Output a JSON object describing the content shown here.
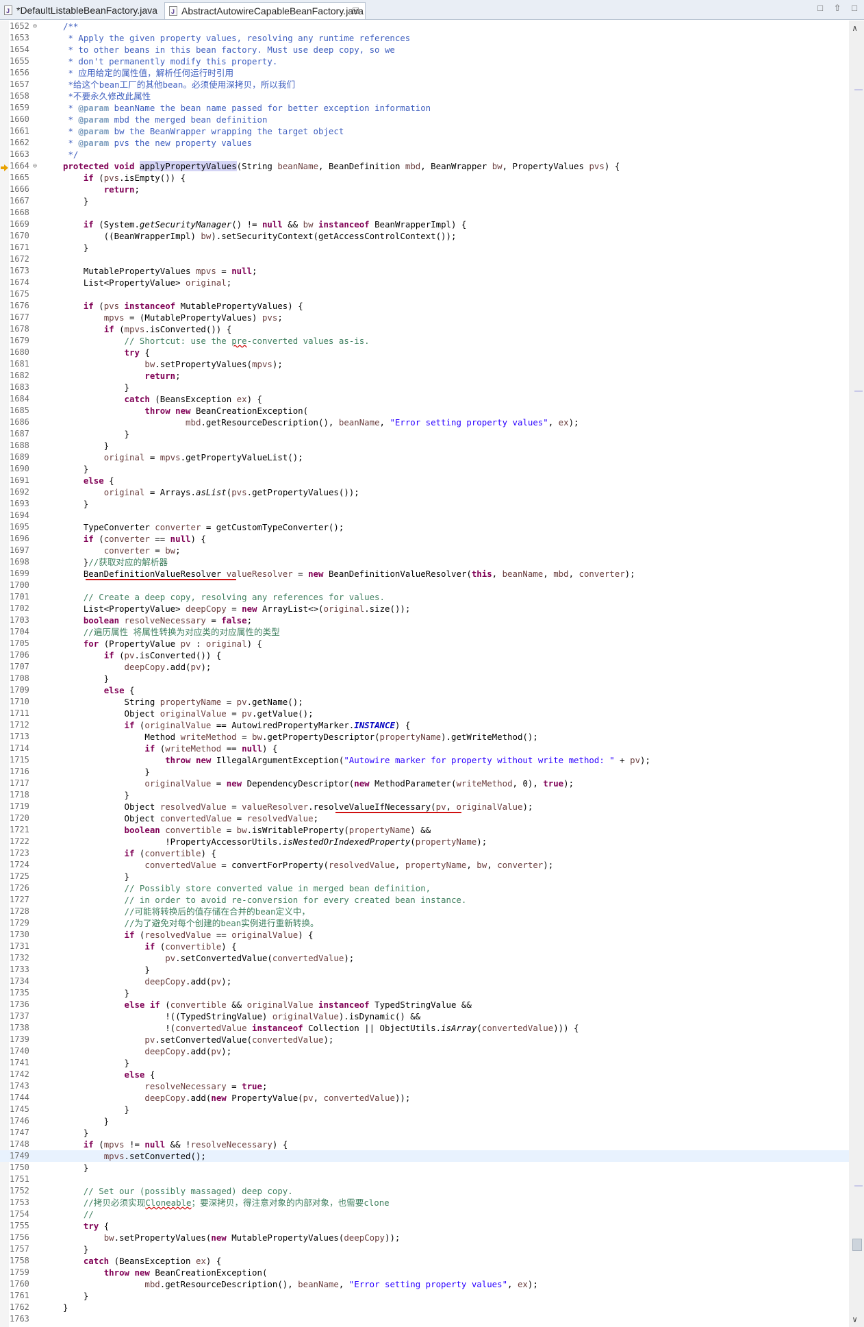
{
  "tabs": [
    {
      "label": "*DefaultListableBeanFactory.java"
    },
    {
      "label": "AbstractAutowireCapableBeanFactory.java",
      "close": "☒"
    }
  ],
  "window_controls": [
    "□",
    "⇧",
    "□"
  ],
  "scrollbar": {
    "up": "∧",
    "down": "∨"
  },
  "colors": {
    "keyword": "#7f0055",
    "comment": "#3f7f5f",
    "javadoc": "#3f5fbf",
    "string": "#2a00ff",
    "field": "#0000c0",
    "annotation_underline": "#d01010"
  },
  "editor": {
    "first_line": 1652,
    "last_line": 1763,
    "highlighted_line": 1749,
    "lines": [
      "/**",
      " * Apply the given property values, resolving any runtime references",
      " * to other beans in this bean factory. Must use deep copy, so we",
      " * don't permanently modify this property.",
      " * 应用给定的属性值，解析任何运行时引用",
      " *给这个bean工厂的其他bean。必须使用深拷贝，所以我们",
      " *不要永久修改此属性",
      " * @param beanName the bean name passed for better exception information",
      " * @param mbd the merged bean definition",
      " * @param bw the BeanWrapper wrapping the target object",
      " * @param pvs the new property values",
      " */",
      "protected void applyPropertyValues(String beanName, BeanDefinition mbd, BeanWrapper bw, PropertyValues pvs) {",
      "    if (pvs.isEmpty()) {",
      "        return;",
      "    }",
      "",
      "    if (System.getSecurityManager() != null && bw instanceof BeanWrapperImpl) {",
      "        ((BeanWrapperImpl) bw).setSecurityContext(getAccessControlContext());",
      "    }",
      "",
      "    MutablePropertyValues mpvs = null;",
      "    List<PropertyValue> original;",
      "",
      "    if (pvs instanceof MutablePropertyValues) {",
      "        mpvs = (MutablePropertyValues) pvs;",
      "        if (mpvs.isConverted()) {",
      "            // Shortcut: use the pre-converted values as-is.",
      "            try {",
      "                bw.setPropertyValues(mpvs);",
      "                return;",
      "            }",
      "            catch (BeansException ex) {",
      "                throw new BeanCreationException(",
      "                        mbd.getResourceDescription(), beanName, \"Error setting property values\", ex);",
      "            }",
      "        }",
      "        original = mpvs.getPropertyValueList();",
      "    }",
      "    else {",
      "        original = Arrays.asList(pvs.getPropertyValues());",
      "    }",
      "",
      "    TypeConverter converter = getCustomTypeConverter();",
      "    if (converter == null) {",
      "        converter = bw;",
      "    }//获取对应的解析器",
      "    BeanDefinitionValueResolver valueResolver = new BeanDefinitionValueResolver(this, beanName, mbd, converter);",
      "",
      "    // Create a deep copy, resolving any references for values.",
      "    List<PropertyValue> deepCopy = new ArrayList<>(original.size());",
      "    boolean resolveNecessary = false;",
      "    //遍历属性 将属性转换为对应类的对应属性的类型",
      "    for (PropertyValue pv : original) {",
      "        if (pv.isConverted()) {",
      "            deepCopy.add(pv);",
      "        }",
      "        else {",
      "            String propertyName = pv.getName();",
      "            Object originalValue = pv.getValue();",
      "            if (originalValue == AutowiredPropertyMarker.INSTANCE) {",
      "                Method writeMethod = bw.getPropertyDescriptor(propertyName).getWriteMethod();",
      "                if (writeMethod == null) {",
      "                    throw new IllegalArgumentException(\"Autowire marker for property without write method: \" + pv);",
      "                }",
      "                originalValue = new DependencyDescriptor(new MethodParameter(writeMethod, 0), true);",
      "            }",
      "            Object resolvedValue = valueResolver.resolveValueIfNecessary(pv, originalValue);",
      "            Object convertedValue = resolvedValue;",
      "            boolean convertible = bw.isWritableProperty(propertyName) &&",
      "                    !PropertyAccessorUtils.isNestedOrIndexedProperty(propertyName);",
      "            if (convertible) {",
      "                convertedValue = convertForProperty(resolvedValue, propertyName, bw, converter);",
      "            }",
      "            // Possibly store converted value in merged bean definition,",
      "            // in order to avoid re-conversion for every created bean instance.",
      "            //可能将转换后的值存储在合并的bean定义中，",
      "            //为了避免对每个创建的bean实例进行重新转换。",
      "            if (resolvedValue == originalValue) {",
      "                if (convertible) {",
      "                    pv.setConvertedValue(convertedValue);",
      "                }",
      "                deepCopy.add(pv);",
      "            }",
      "            else if (convertible && originalValue instanceof TypedStringValue &&",
      "                    !((TypedStringValue) originalValue).isDynamic() &&",
      "                    !(convertedValue instanceof Collection || ObjectUtils.isArray(convertedValue))) {",
      "                pv.setConvertedValue(convertedValue);",
      "                deepCopy.add(pv);",
      "            }",
      "            else {",
      "                resolveNecessary = true;",
      "                deepCopy.add(new PropertyValue(pv, convertedValue));",
      "            }",
      "        }",
      "    }",
      "    if (mpvs != null && !resolveNecessary) {",
      "        mpvs.setConverted();",
      "    }",
      "",
      "    // Set our (possibly massaged) deep copy.",
      "    //拷贝必须实现Cloneable；要深拷贝，得注意对象的内部对象，也需要clone",
      "    //",
      "    try {",
      "        bw.setPropertyValues(new MutablePropertyValues(deepCopy));",
      "    }",
      "    catch (BeansException ex) {",
      "        throw new BeanCreationException(",
      "                mbd.getResourceDescription(), beanName, \"Error setting property values\", ex);",
      "    }",
      "}",
      ""
    ]
  }
}
